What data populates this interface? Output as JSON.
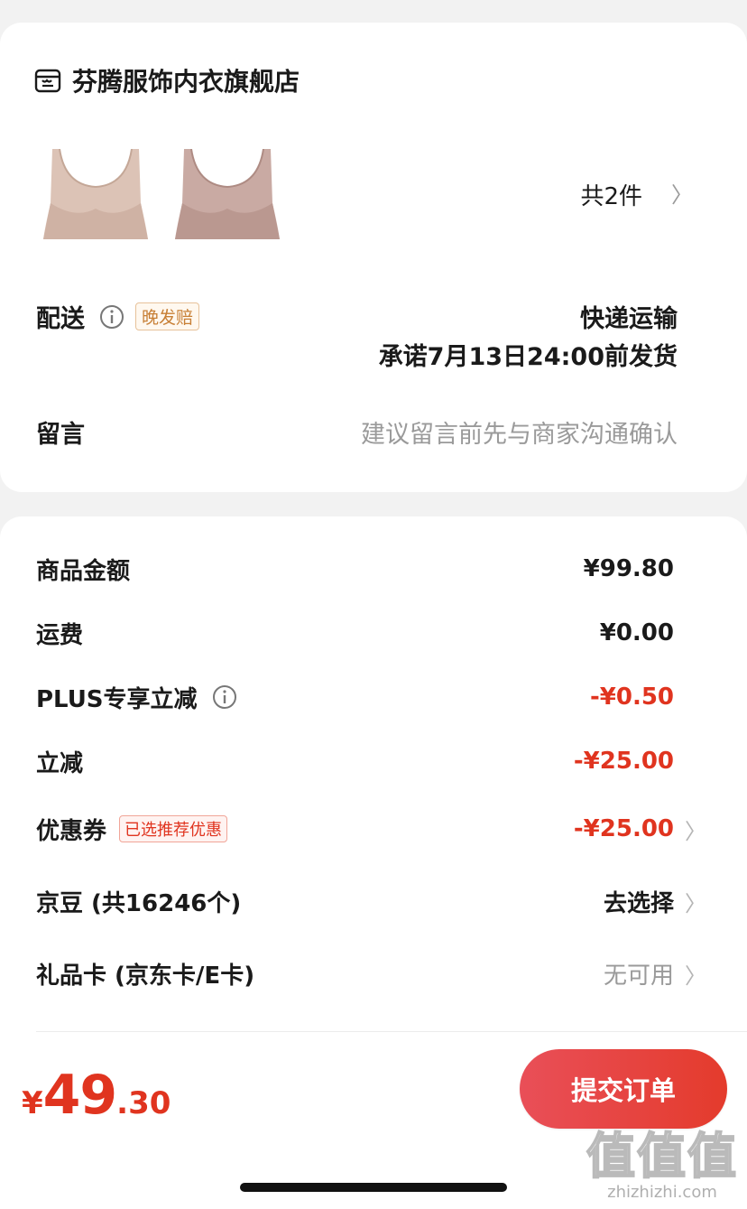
{
  "store": {
    "name": "芬腾服饰内衣旗舰店",
    "icon": "store-icon"
  },
  "products": {
    "count_text": "共2件",
    "items": [
      {
        "name": "product-bra-nude",
        "color": "#dcc3b6"
      },
      {
        "name": "product-bra-mauve",
        "color": "#c9aaa3"
      }
    ]
  },
  "delivery": {
    "label": "配送",
    "badge": "晚发赔",
    "method": "快递运输",
    "promise": "承诺7月13日24:00前发货"
  },
  "message": {
    "label": "留言",
    "placeholder": "建议留言前先与商家沟通确认"
  },
  "price_rows": [
    {
      "label": "商品金额",
      "value": "¥99.80"
    },
    {
      "label": "运费",
      "value": "¥0.00"
    },
    {
      "label": "PLUS专享立减",
      "value": "-¥0.50"
    },
    {
      "label": "立减",
      "value": "-¥25.00"
    },
    {
      "label": "优惠券",
      "badge": "已选推荐优惠",
      "value": "-¥25.00"
    },
    {
      "label": "京豆 (共16246个)",
      "value": "去选择"
    },
    {
      "label": "礼品卡 (京东卡/E卡)",
      "value": "无可用"
    }
  ],
  "footer": {
    "currency": "¥",
    "total_int": "49",
    "total_dec": ".30",
    "submit_label": "提交订单"
  },
  "watermark": {
    "logo": "值值值",
    "text": "zhizhizhi.com"
  },
  "colors": {
    "accent": "#e43b2c",
    "late_badge": "#c77f35",
    "muted": "#9a9a9a"
  }
}
